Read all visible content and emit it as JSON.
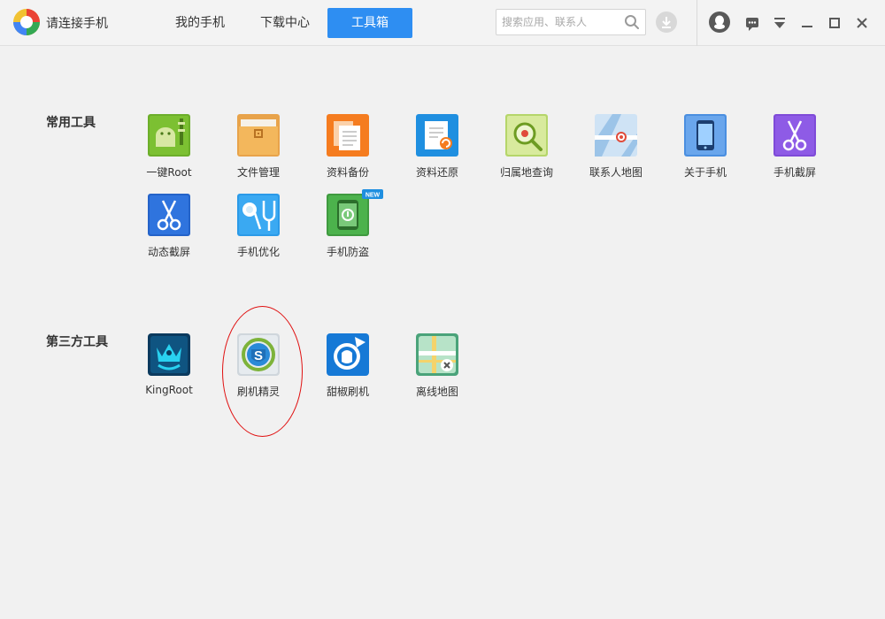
{
  "header": {
    "app_title": "请连接手机",
    "tabs": [
      {
        "label": "我的手机",
        "active": false
      },
      {
        "label": "下载中心",
        "active": false
      },
      {
        "label": "工具箱",
        "active": true
      }
    ],
    "search": {
      "placeholder": "搜索应用、联系人"
    },
    "icons": [
      "search-icon",
      "download-icon",
      "qq-avatar-icon",
      "message-icon",
      "menu-dropdown-icon",
      "minimize-icon",
      "maximize-icon",
      "close-icon"
    ]
  },
  "sections": {
    "common": {
      "title": "常用工具",
      "tools": [
        {
          "label": "一键Root",
          "icon": "android-root-icon"
        },
        {
          "label": "文件管理",
          "icon": "folder-icon"
        },
        {
          "label": "资料备份",
          "icon": "backup-icon"
        },
        {
          "label": "资料还原",
          "icon": "restore-icon"
        },
        {
          "label": "归属地查询",
          "icon": "location-search-icon"
        },
        {
          "label": "联系人地图",
          "icon": "contact-map-icon"
        },
        {
          "label": "关于手机",
          "icon": "phone-icon"
        },
        {
          "label": "手机截屏",
          "icon": "scissors-icon"
        },
        {
          "label": "动态截屏",
          "icon": "scissors-icon"
        },
        {
          "label": "手机优化",
          "icon": "stethoscope-icon"
        },
        {
          "label": "手机防盗",
          "icon": "phone-guard-icon",
          "badge": "NEW"
        }
      ]
    },
    "third_party": {
      "title": "第三方工具",
      "tools": [
        {
          "label": "KingRoot",
          "icon": "kingroot-icon"
        },
        {
          "label": "刷机精灵",
          "icon": "shuaji-jingling-icon"
        },
        {
          "label": "甜椒刷机",
          "icon": "tianjiao-icon"
        },
        {
          "label": "离线地图",
          "icon": "offline-map-icon"
        }
      ]
    }
  },
  "colors": {
    "accent": "#2e8ef2",
    "background": "#f1f1f1",
    "highlight_ring": "#e01010"
  }
}
